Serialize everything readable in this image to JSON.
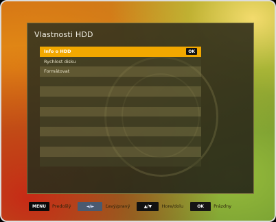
{
  "dialog": {
    "title": "Vlastnosti HDD",
    "items": [
      {
        "label": "Info o HDD",
        "selected": true,
        "badge": "OK"
      },
      {
        "label": "Rychlost disku",
        "selected": false
      },
      {
        "label": "Formátovat",
        "selected": false
      }
    ]
  },
  "footer": {
    "hints": [
      {
        "key": "MENU",
        "label": "Predošlý"
      },
      {
        "key": "◄/►",
        "label": "Ľavý/pravý"
      },
      {
        "key": "▲/▼",
        "label": "Hore/dolu"
      },
      {
        "key": "OK",
        "label": "Prázdny"
      }
    ]
  },
  "colors": {
    "highlight": "#f2a800",
    "panel": "#3c371e"
  }
}
